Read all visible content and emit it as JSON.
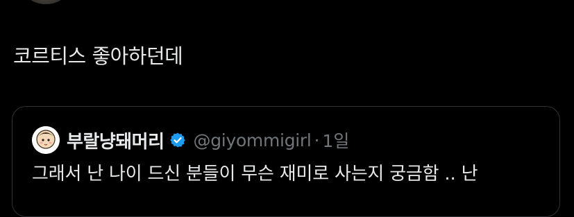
{
  "post": {
    "text": "코르티스 좋아하던데"
  },
  "quote": {
    "display_name": "부랄냥돼머리",
    "verified": true,
    "verified_icon": "verified-badge-icon",
    "handle": "@giyommigirl",
    "separator": "·",
    "time": "1일",
    "body": "그래서 난 나이 드신 분들이 무슨 재미로 사는지 궁금함 .. 난"
  },
  "colors": {
    "background": "#000000",
    "text_primary": "#e7e9ea",
    "text_secondary": "#71767b",
    "border": "#2f3336",
    "verified_blue": "#1d9bf0"
  }
}
